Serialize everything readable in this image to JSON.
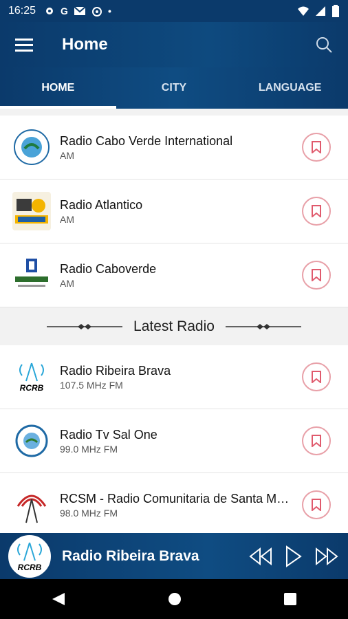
{
  "status": {
    "time": "16:25",
    "icons": [
      "gear-icon",
      "google-icon",
      "mail-icon",
      "radio-icon",
      "dot-icon"
    ],
    "right_icons": [
      "wifi-icon",
      "signal-icon",
      "battery-icon"
    ]
  },
  "appbar": {
    "title": "Home"
  },
  "tabs": [
    {
      "label": "HOME",
      "active": true
    },
    {
      "label": "CITY",
      "active": false
    },
    {
      "label": "LANGUAGE",
      "active": false
    }
  ],
  "stations": [
    {
      "name": "Radio Cabo Verde International",
      "band": "AM",
      "logo": "radio-cabo-verde-international-logo"
    },
    {
      "name": "Radio Atlantico",
      "band": "AM",
      "logo": "radio-atlantico-logo"
    },
    {
      "name": "Radio Caboverde",
      "band": "AM",
      "logo": "radio-caboverde-logo"
    }
  ],
  "latest": {
    "title": "Latest Radio",
    "items": [
      {
        "name": "Radio Ribeira Brava",
        "band": "107.5 MHz FM",
        "logo": "rcrb-logo"
      },
      {
        "name": "Radio Tv Sal One",
        "band": "99.0 MHz FM",
        "logo": "radio-tv-sal-one-logo"
      },
      {
        "name": "RCSM - Radio Comunitaria de Santa Maria",
        "band": "98.0 MHz FM",
        "logo": "rcsm-logo"
      }
    ]
  },
  "player": {
    "title": "Radio Ribeira Brava",
    "logo_text": "RCRB"
  },
  "colors": {
    "primary": "#0b3a6b",
    "accent": "#e05a6d",
    "tab_indicator": "#ffffff"
  }
}
